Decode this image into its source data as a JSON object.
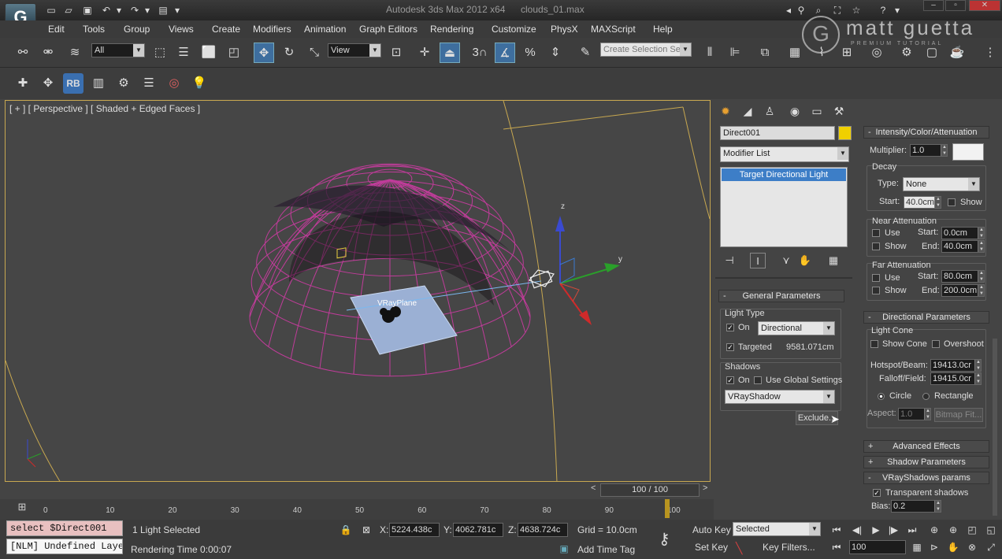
{
  "app": {
    "logo_letter": "G",
    "title": "Autodesk 3ds Max  2012 x64",
    "file": "clouds_01.max",
    "window_controls": [
      "–",
      "▫",
      "✕"
    ]
  },
  "watermark": {
    "text": "matt guetta",
    "sub": "PREMIUM TUTORIAL",
    "logo": "G"
  },
  "menu": [
    "Edit",
    "Tools",
    "Group",
    "Views",
    "Create",
    "Modifiers",
    "Animation",
    "Graph Editors",
    "Rendering",
    "Customize",
    "PhysX",
    "MAXScript",
    "Help"
  ],
  "toolbar": {
    "selection_filter": "All",
    "ref_coord": "View",
    "snap_angle": "3",
    "named_selection_placeholder": "Create Selection Se",
    "rb_label": "RB"
  },
  "viewport": {
    "label": "[ + ] [ Perspective ] [ Shaded + Edged Faces ]",
    "object_label": "VRayPlane",
    "axis_z": "z",
    "axis_y": "y",
    "accent": "#c8a850",
    "dome_color": "#c03c9a"
  },
  "command_panel": {
    "object_name": "Direct001",
    "object_color": "#f0d000",
    "modifier_list": "Modifier List",
    "stack_item": "Target Directional Light"
  },
  "general_params": {
    "title": "General Parameters",
    "light_type_group": "Light Type",
    "on_label": "On",
    "on_checked": true,
    "type_value": "Directional",
    "targeted_label": "Targeted",
    "targeted_checked": true,
    "target_distance": "9581.071cm",
    "shadows_group": "Shadows",
    "shadows_on_label": "On",
    "use_global_label": "Use Global Settings",
    "shadow_type": "VRayShadow",
    "exclude_label": "Exclude..."
  },
  "intensity": {
    "title": "Intensity/Color/Attenuation",
    "multiplier_label": "Multiplier:",
    "multiplier_value": "1.0",
    "decay_group": "Decay",
    "type_label": "Type:",
    "type_value": "None",
    "start_label": "Start:",
    "start_value": "40.0cm",
    "show_label": "Show",
    "near_group": "Near Attenuation",
    "near_use": "Use",
    "near_show": "Show",
    "near_start_label": "Start:",
    "near_start": "0.0cm",
    "near_end_label": "End:",
    "near_end": "40.0cm",
    "far_group": "Far Attenuation",
    "far_use": "Use",
    "far_show": "Show",
    "far_start_label": "Start:",
    "far_start": "80.0cm",
    "far_end_label": "End:",
    "far_end": "200.0cm"
  },
  "directional": {
    "title": "Directional Parameters",
    "cone_group": "Light Cone",
    "show_cone": "Show Cone",
    "overshoot": "Overshoot",
    "hotspot_label": "Hotspot/Beam:",
    "hotspot_value": "19413.0cr",
    "falloff_label": "Falloff/Field:",
    "falloff_value": "19415.0cr",
    "circle": "Circle",
    "rectangle": "Rectangle",
    "aspect_label": "Aspect:",
    "aspect_value": "1.0",
    "bitmap_fit": "Bitmap Fit..."
  },
  "rollouts_collapsed": [
    {
      "sign": "+",
      "title": "Advanced Effects"
    },
    {
      "sign": "+",
      "title": "Shadow Parameters"
    }
  ],
  "vray_shadows": {
    "sign": "-",
    "title": "VRayShadows params",
    "transparent": "Transparent shadows",
    "transparent_checked": true,
    "bias_label": "Bias:",
    "bias_value": "0.2"
  },
  "timeline": {
    "slider_label": "100 / 100",
    "frame_fraction": 1.0,
    "ticks": [
      "0",
      "10",
      "20",
      "30",
      "40",
      "50",
      "60",
      "70",
      "80",
      "90",
      "100"
    ],
    "prev": "<",
    "next": ">"
  },
  "status": {
    "maxscript_line1": "select $Direct001",
    "maxscript_line2": "[NLM] Undefined Laye",
    "selection": "1 Light Selected",
    "rendering_time": "Rendering Time  0:00:07",
    "x_label": "X:",
    "x_value": "5224.438c",
    "y_label": "Y:",
    "y_value": "4062.781c",
    "z_label": "Z:",
    "z_value": "4638.724c",
    "grid": "Grid = 10.0cm",
    "add_time_tag": "Add Time Tag",
    "auto_key": "Auto Key",
    "set_key": "Set Key",
    "selected_dropdown": "Selected",
    "key_filters": "Key Filters...",
    "frame_value": "100"
  }
}
